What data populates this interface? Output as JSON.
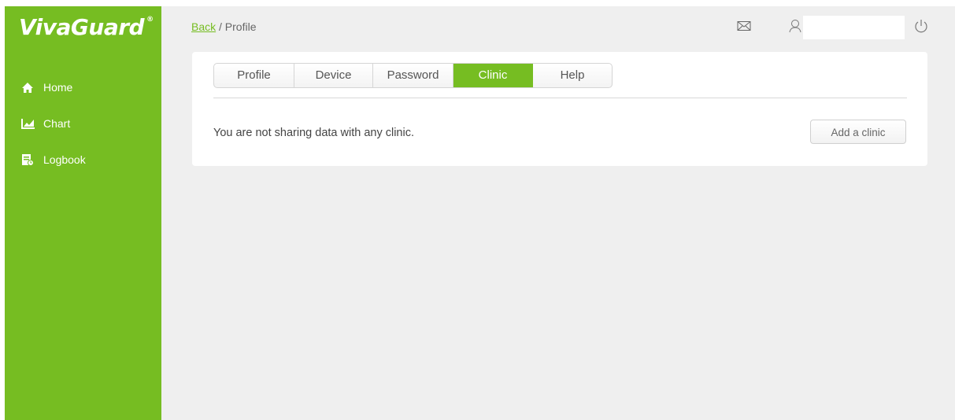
{
  "brand": {
    "logo_text": "VivaGuard",
    "registered_mark": "®",
    "accent_color": "#76bd22"
  },
  "sidebar": {
    "items": [
      {
        "label": "Home",
        "icon": "home-icon"
      },
      {
        "label": "Chart",
        "icon": "chart-icon"
      },
      {
        "label": "Logbook",
        "icon": "logbook-icon"
      }
    ]
  },
  "header": {
    "back_label": "Back",
    "separator": " / ",
    "current_page": "Profile",
    "icons": [
      "mail-icon",
      "user-icon",
      "power-icon"
    ],
    "username": ""
  },
  "tabs": {
    "items": [
      {
        "label": "Profile"
      },
      {
        "label": "Device"
      },
      {
        "label": "Password"
      },
      {
        "label": "Clinic"
      },
      {
        "label": "Help"
      }
    ],
    "active": "Clinic"
  },
  "clinic": {
    "message": "You are not sharing data with any clinic.",
    "add_button_label": "Add a clinic"
  }
}
